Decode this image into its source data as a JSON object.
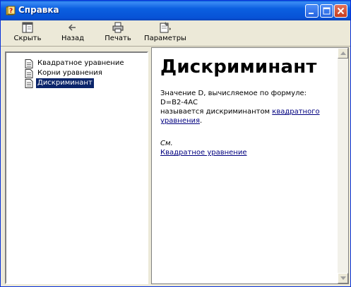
{
  "window": {
    "title": "Справка"
  },
  "toolbar": {
    "hide_label": "Скрыть",
    "back_label": "Назад",
    "print_label": "Печать",
    "params_label": "Параметры"
  },
  "tree": {
    "items": [
      {
        "label": "Квадратное уравнение",
        "selected": false
      },
      {
        "label": "Корни уравнения",
        "selected": false
      },
      {
        "label": "Дискриминант",
        "selected": true
      }
    ]
  },
  "article": {
    "title": "Дискриминант",
    "line1": "Значение D, вычисляемое по формуле:",
    "line2": "D=B2-4AC",
    "line3_prefix": "называется дискриминантом ",
    "line3_link": "квадратного уравнения",
    "line3_suffix": ".",
    "see_label": "См.",
    "see_link": "Квадратное уравнение"
  },
  "colors": {
    "titlebar": "#0b5fe0",
    "selection": "#0a246a",
    "link": "#00007f"
  }
}
